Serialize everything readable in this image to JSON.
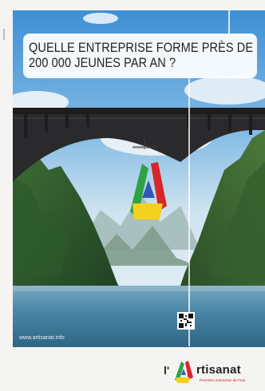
{
  "headline": {
    "line1": "QUELLE ENTREPRISE FORME PRÈS DE",
    "line2": "200 000 JEUNES PAR AN ?"
  },
  "url": "www.artisanat.info",
  "logo": {
    "prefix": "l'",
    "word": "rtisanat",
    "tagline": "Première entreprise de Fran"
  },
  "colors": {
    "red": "#d8262b",
    "green": "#2fa344",
    "blue": "#2f58b8",
    "yellow": "#f4d11c"
  }
}
